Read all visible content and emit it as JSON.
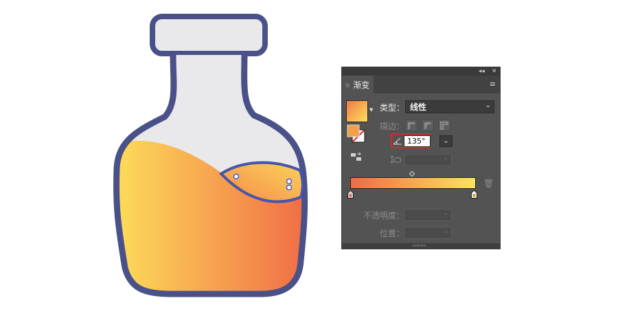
{
  "colors": {
    "bottle_outline": "#4a5189",
    "bottle_glass": "#e9e9eb",
    "liquid_start": "#fde05a",
    "liquid_end": "#f06b46",
    "selection_blue": "#3b5bdb",
    "panel_bg": "#535353",
    "highlight_red": "#e0232a"
  },
  "panel": {
    "tab_label": "渐变",
    "collapse_icon": "double-chevron-left-icon",
    "close_icon": "close-x-icon",
    "menu_icon": "hamburger-menu-icon",
    "type_label": "类型：",
    "type_value": "线性",
    "stroke_label": "描边：",
    "angle_value": "135°",
    "opacity_label": "不透明度：",
    "position_label": "位置："
  }
}
